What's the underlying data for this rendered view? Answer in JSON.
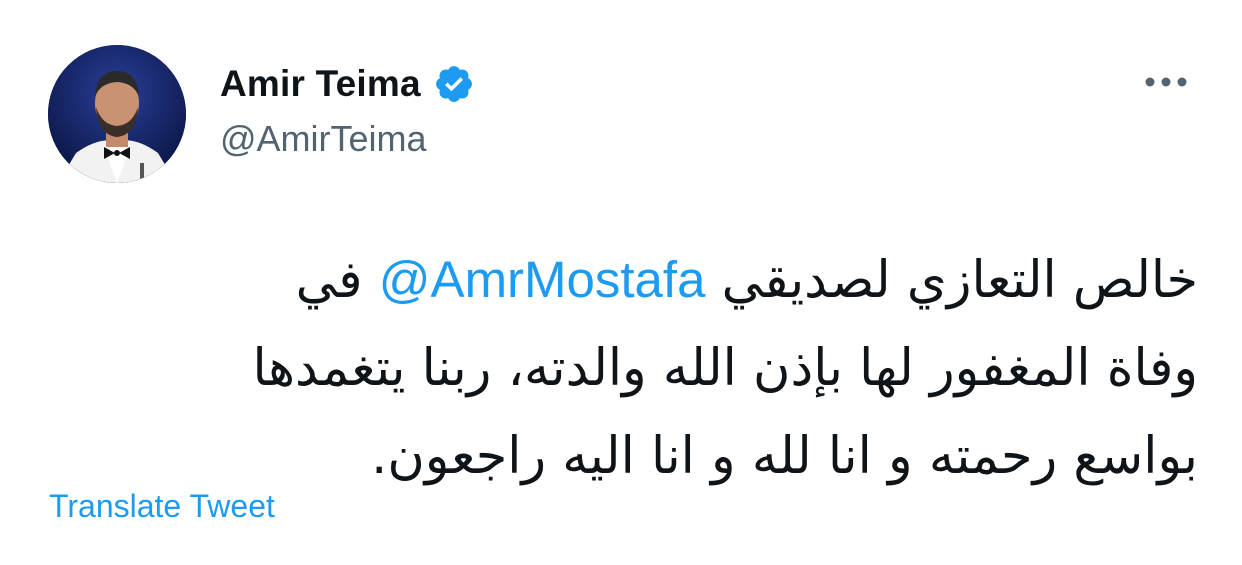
{
  "author": {
    "display_name": "Amir Teima",
    "handle": "@AmirTeima",
    "verified": true
  },
  "tweet": {
    "line1_before": "خالص التعازي لصديقي ",
    "mention": "@AmrMostafa",
    "line1_after": " في",
    "line2": "وفاة المغفور لها بإذن الله والدته، ربنا يتغمدها",
    "line3": "بواسع رحمته و انا لله و انا اليه راجعون."
  },
  "actions": {
    "translate_label": "Translate Tweet"
  },
  "icons": {
    "verified": "verified-badge-icon",
    "more": "more-options-icon"
  },
  "colors": {
    "accent": "#1d9bf0",
    "text": "#0f1419",
    "muted": "#536471"
  }
}
